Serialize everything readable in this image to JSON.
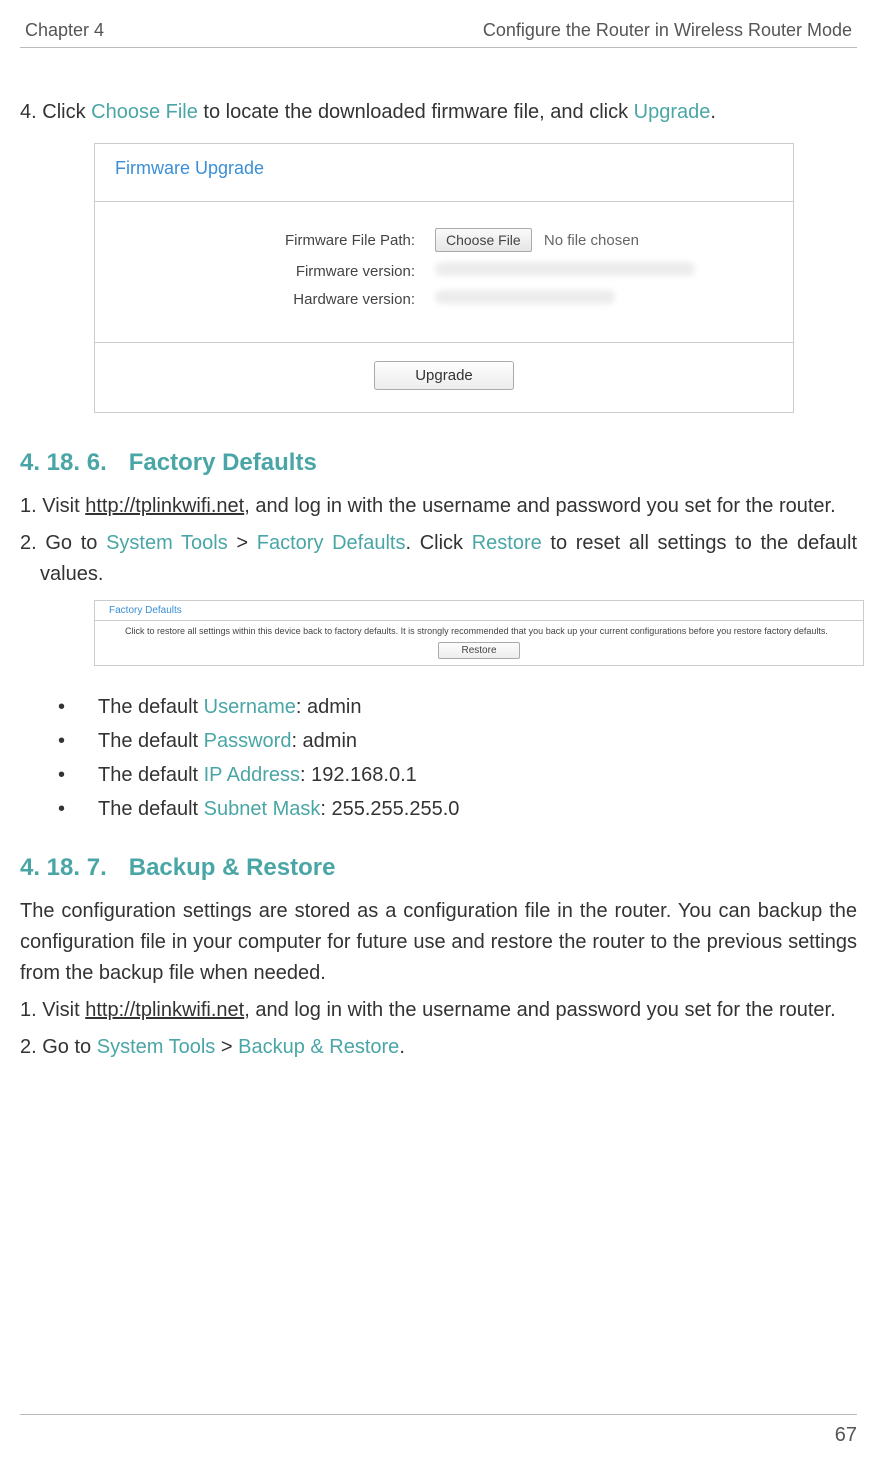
{
  "header": {
    "chapter": "Chapter 4",
    "title": "Configure the Router in Wireless Router Mode"
  },
  "step4": {
    "num": "4. ",
    "prefix": "Click ",
    "choose_file": "Choose File",
    "mid": " to locate the downloaded firmware file, and click ",
    "upgrade": "Upgrade",
    "suffix": "."
  },
  "firmware_shot": {
    "title": "Firmware Upgrade",
    "rows": {
      "file_label": "Firmware File Path:",
      "choose_btn": "Choose File",
      "no_file": "No file chosen",
      "fw_version_label": "Firmware version:",
      "hw_version_label": "Hardware version:"
    },
    "upgrade_btn": "Upgrade"
  },
  "section6": {
    "num": "4. 18. 6.",
    "title": "Factory Defaults",
    "step1_num": "1. ",
    "step1_a": "Visit ",
    "step1_link": "http://tplinkwifi.net",
    "step1_b": ", and log in with the username and password you set for the router.",
    "step2_num": "2. ",
    "step2_a": "Go to ",
    "step2_sys": "System Tools",
    "step2_gt": " > ",
    "step2_fd": "Factory Defaults",
    "step2_b": ". Click ",
    "step2_restore": "Restore",
    "step2_c": " to reset all settings to the default values."
  },
  "factory_shot": {
    "title": "Factory Defaults",
    "text": "Click to restore all settings within this device back to factory defaults. It is strongly recommended that you back up your current configurations before you restore factory defaults.",
    "restore_btn": "Restore"
  },
  "defaults": [
    {
      "prefix": "The default ",
      "term": "Username",
      "value": ": admin"
    },
    {
      "prefix": "The default ",
      "term": "Password",
      "value": ": admin"
    },
    {
      "prefix": "The default ",
      "term": "IP Address",
      "value": ": 192.168.0.1"
    },
    {
      "prefix": "The default ",
      "term": "Subnet Mask",
      "value": ": 255.255.255.0"
    }
  ],
  "section7": {
    "num": "4. 18. 7.",
    "title": "Backup & Restore",
    "para": "The configuration settings are stored as a configuration file in the router. You can backup the configuration file in your computer for future use and restore the router to the previous settings from the backup file when needed.",
    "step1_num": "1. ",
    "step1_a": "Visit ",
    "step1_link": "http://tplinkwifi.net",
    "step1_b": ", and log in with the username and password you set for the router.",
    "step2_num": "2. ",
    "step2_a": "Go to ",
    "step2_sys": "System Tools",
    "step2_gt": " > ",
    "step2_br": "Backup & Restore",
    "step2_suffix": "."
  },
  "page_number": "67"
}
